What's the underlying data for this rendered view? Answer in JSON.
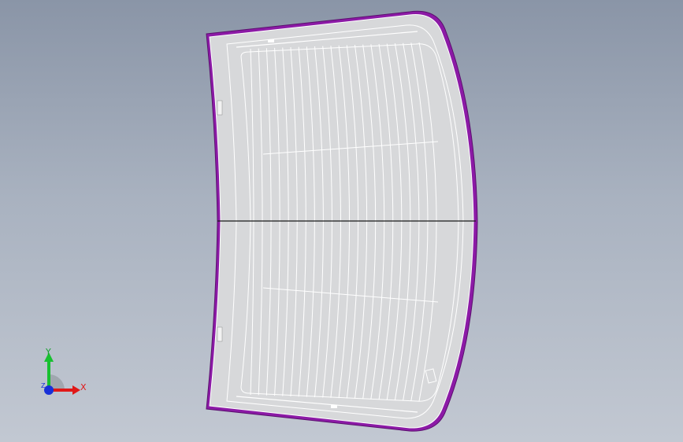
{
  "viewport": {
    "colors": {
      "background_top": "#8a95a7",
      "background_bottom": "#c2c8d2",
      "glass_fill": "#d7d8da",
      "glass_edge": "#8c1aa6",
      "defroster_lines": "#ffffff",
      "axis_x": "#e01818",
      "axis_y": "#18c030",
      "axis_z": "#1830d8"
    },
    "model": {
      "name": "rear-window-glass",
      "view": "front"
    },
    "triad": {
      "x_label": "X",
      "y_label": "Y",
      "z_label": "Z"
    }
  }
}
